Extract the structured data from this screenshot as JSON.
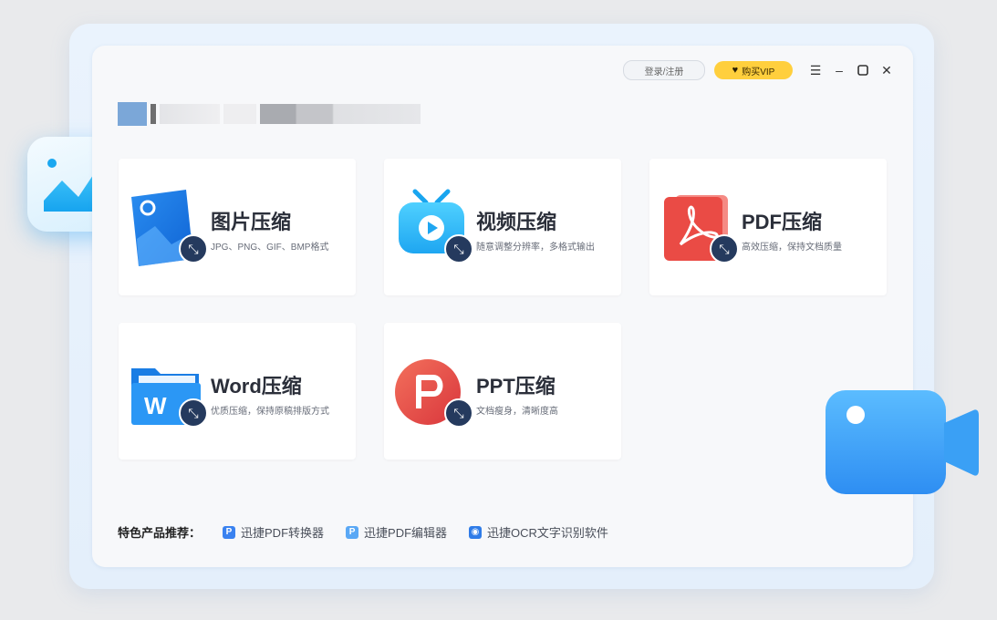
{
  "topbar": {
    "login_label": "登录/注册",
    "vip_label": "购买VIP"
  },
  "cards": [
    {
      "title": "图片压缩",
      "desc": "JPG、PNG、GIF、BMP格式",
      "icon": "image-file-icon"
    },
    {
      "title": "视频压缩",
      "desc": "随意调整分辨率，多格式输出",
      "icon": "tv-icon"
    },
    {
      "title": "PDF压缩",
      "desc": "高效压缩，保持文档质量",
      "icon": "pdf-icon"
    },
    {
      "title": "Word压缩",
      "desc": "优质压缩，保持原稿排版方式",
      "icon": "word-folder-icon"
    },
    {
      "title": "PPT压缩",
      "desc": "文档瘦身，清晰度高",
      "icon": "ppt-icon"
    }
  ],
  "footer": {
    "label": "特色产品推荐：",
    "links": [
      "迅捷PDF转换器",
      "迅捷PDF编辑器",
      "迅捷OCR文字识别软件"
    ]
  },
  "colors": {
    "accent": "#3a82f0",
    "vip": "#ffcf3d",
    "badge": "#253a5e"
  }
}
